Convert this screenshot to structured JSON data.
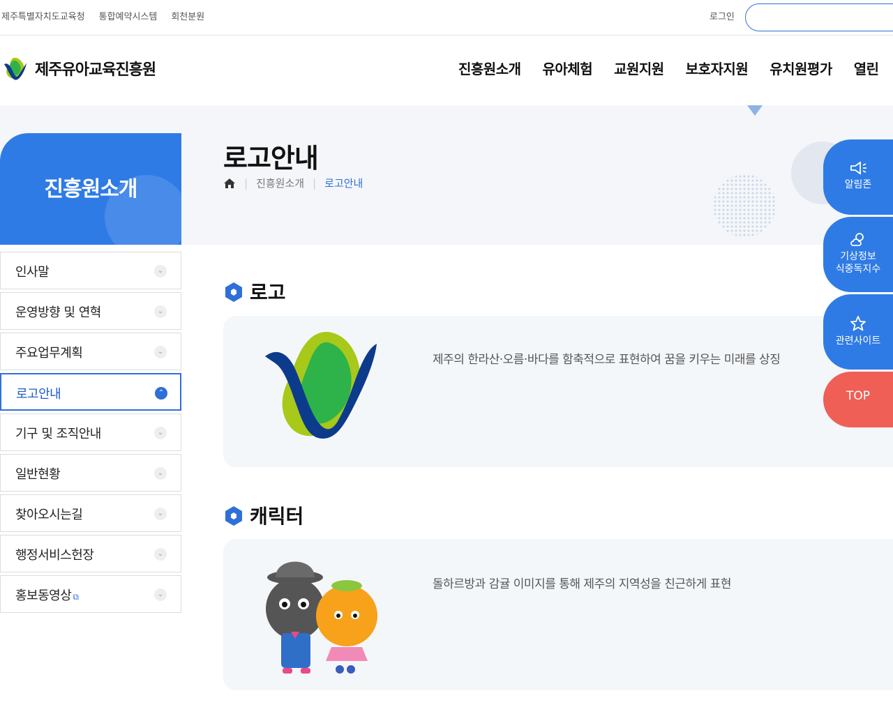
{
  "util": {
    "links": [
      "제주특별자치도교육청",
      "통합예약시스템",
      "회천분원"
    ],
    "login": "로그인"
  },
  "header": {
    "brand": "제주유아교육진흥원",
    "nav": [
      "진흥원소개",
      "유아체험",
      "교원지원",
      "보호자지원",
      "유치원평가",
      "열린"
    ]
  },
  "lnb": {
    "title": "진흥원소개",
    "items": [
      {
        "label": "인사말"
      },
      {
        "label": "운영방향 및 연혁"
      },
      {
        "label": "주요업무계획"
      },
      {
        "label": "로고안내"
      },
      {
        "label": "기구 및 조직안내"
      },
      {
        "label": "일반현황"
      },
      {
        "label": "찾아오시는길"
      },
      {
        "label": "행정서비스헌장"
      },
      {
        "label": "홍보동영상"
      }
    ],
    "active_index": 3
  },
  "page": {
    "title": "로고안내",
    "breadcrumb": [
      "진흥원소개",
      "로고안내"
    ]
  },
  "sections": {
    "logo": {
      "title": "로고",
      "description": "제주의 한라산·오름·바다를 함축적으로 표현하여 꿈을 키우는 미래를 상징"
    },
    "character": {
      "title": "캐릭터",
      "description": "돌하르방과 감귤 이미지를 통해 제주의 지역성을 친근하게 표현"
    }
  },
  "quick": {
    "notice": "알림존",
    "weather_line1": "기상정보",
    "weather_line2": "식중독지수",
    "related": "관련사이트",
    "top": "TOP"
  },
  "colors": {
    "primary": "#2f7be5",
    "accent_blue": "#2f6fd8",
    "top_button": "#ef5f56",
    "logo_green": "#2db34a",
    "logo_lime": "#a8c81a",
    "logo_navy": "#0d3b8c"
  }
}
